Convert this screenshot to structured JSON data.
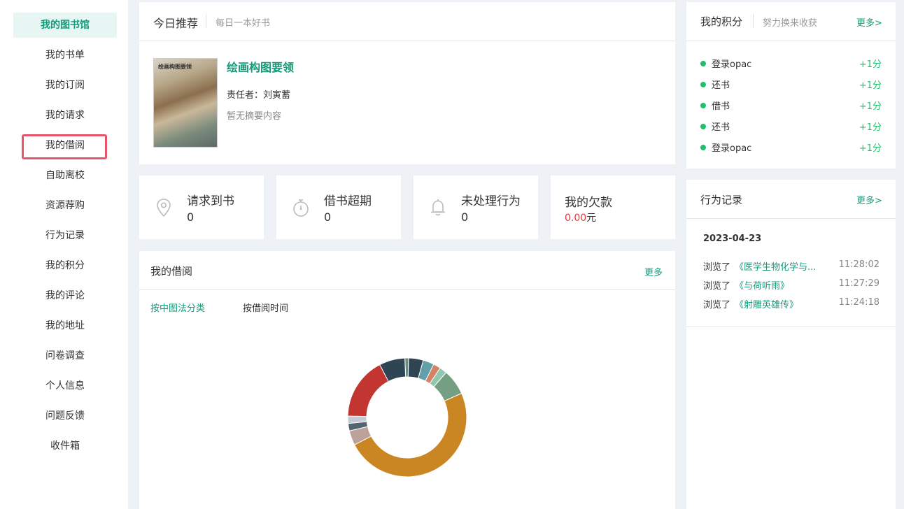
{
  "sidebar": {
    "items": [
      {
        "label": "我的图书馆",
        "active": true
      },
      {
        "label": "我的书单"
      },
      {
        "label": "我的订阅"
      },
      {
        "label": "我的请求"
      },
      {
        "label": "我的借阅"
      },
      {
        "label": "自助离校"
      },
      {
        "label": "资源荐购"
      },
      {
        "label": "行为记录"
      },
      {
        "label": "我的积分"
      },
      {
        "label": "我的评论"
      },
      {
        "label": "我的地址"
      },
      {
        "label": "问卷调查"
      },
      {
        "label": "个人信息"
      },
      {
        "label": "问题反馈"
      },
      {
        "label": "收件箱"
      }
    ],
    "highlighted": "我的借阅"
  },
  "recommend": {
    "title": "今日推荐",
    "subtitle": "每日一本好书",
    "book": {
      "cover_text": "绘画构图要领",
      "title": "绘画构图要领",
      "author": "责任者：刘寅蓄",
      "abstract": "暂无摘要内容"
    }
  },
  "stats": [
    {
      "label": "请求到书",
      "value": "0",
      "icon": "location-pin-icon"
    },
    {
      "label": "借书超期",
      "value": "0",
      "icon": "stopwatch-icon"
    },
    {
      "label": "未处理行为",
      "value": "0",
      "icon": "bell-icon"
    },
    {
      "label": "我的欠款",
      "value": "0.00",
      "unit": "元",
      "icon": "none"
    }
  ],
  "borrow": {
    "title": "我的借阅",
    "more": "更多",
    "tabs": [
      {
        "label": "按中图法分类",
        "active": true
      },
      {
        "label": "按借阅时间",
        "active": false
      }
    ]
  },
  "chart_data": {
    "type": "pie",
    "donut": true,
    "values": [
      1,
      4,
      3,
      2,
      2,
      7,
      49,
      4,
      2,
      2,
      17,
      7
    ],
    "colors": [
      "#6b8c7e",
      "#2f4554",
      "#61a0a8",
      "#d48265",
      "#91c7ae",
      "#749f83",
      "#ca8622",
      "#bda29a",
      "#546570",
      "#c4ccd3",
      "#c23531",
      "#2f4554",
      "#d48265"
    ]
  },
  "points": {
    "title": "我的积分",
    "subtitle": "努力换来收获",
    "more": "更多>",
    "rows": [
      {
        "text": "登录opac",
        "pts": "+1分"
      },
      {
        "text": "还书",
        "pts": "+1分"
      },
      {
        "text": "借书",
        "pts": "+1分"
      },
      {
        "text": "还书",
        "pts": "+1分"
      },
      {
        "text": "登录opac",
        "pts": "+1分"
      }
    ]
  },
  "records": {
    "title": "行为记录",
    "more": "更多>",
    "date": "2023-04-23",
    "rows": [
      {
        "action": "浏览了",
        "book": "《医学生物化学与...",
        "time": "11:28:02"
      },
      {
        "action": "浏览了",
        "book": "《与荷听雨》",
        "time": "11:27:29"
      },
      {
        "action": "浏览了",
        "book": "《射雕英雄传》",
        "time": "11:24:18"
      }
    ]
  },
  "colors": {
    "accent": "#16997a",
    "highlight": "#e5566a",
    "points": "#1fbf6e",
    "debt": "#e5373f"
  }
}
